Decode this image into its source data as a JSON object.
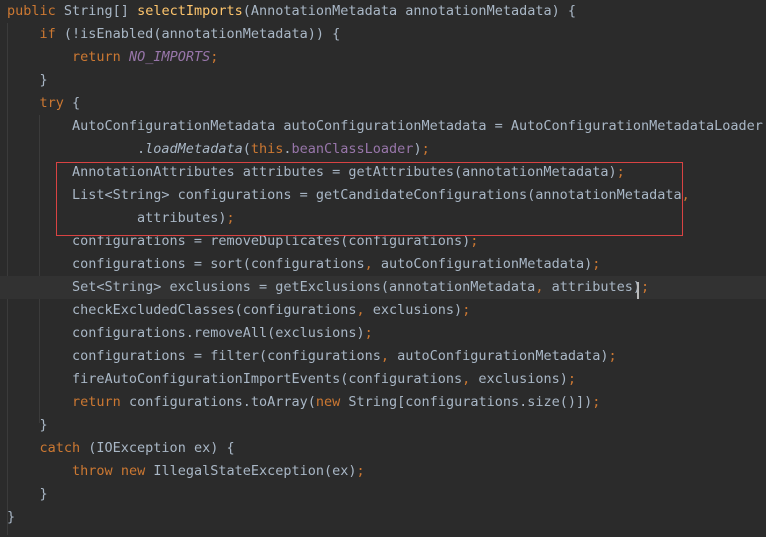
{
  "editor": {
    "theme_colors": {
      "background": "#2b2b2b",
      "current_line": "#323232",
      "keyword": "#cc7832",
      "method_declaration": "#ffc66d",
      "constant_field": "#9876aa",
      "default_text": "#a9b7c6",
      "highlight_box": "#d94343"
    },
    "current_line_number": 13,
    "highlighted_lines": [
      8,
      9,
      10
    ],
    "lines": [
      [
        {
          "t": "public",
          "c": "kw"
        },
        {
          "t": " String[] "
        },
        {
          "t": "selectImports",
          "c": "fn"
        },
        {
          "t": "(AnnotationMetadata annotationMetadata) {"
        }
      ],
      [
        {
          "t": "    "
        },
        {
          "t": "if",
          "c": "kw"
        },
        {
          "t": " (!isEnabled(annotationMetadata)) {"
        }
      ],
      [
        {
          "t": "        "
        },
        {
          "t": "return",
          "c": "kw"
        },
        {
          "t": " "
        },
        {
          "t": "NO_IMPORTS",
          "c": "const"
        },
        {
          "t": ";",
          "c": "kw"
        }
      ],
      [
        {
          "t": "    }"
        }
      ],
      [
        {
          "t": "    "
        },
        {
          "t": "try",
          "c": "kw"
        },
        {
          "t": " {"
        }
      ],
      [
        {
          "t": "        AutoConfigurationMetadata autoConfigurationMetadata = AutoConfigurationMetadataLoader"
        }
      ],
      [
        {
          "t": "                ."
        },
        {
          "t": "loadMetadata",
          "c": "static"
        },
        {
          "t": "("
        },
        {
          "t": "this",
          "c": "kw"
        },
        {
          "t": "."
        },
        {
          "t": "beanClassLoader",
          "c": "field"
        },
        {
          "t": ")"
        },
        {
          "t": ";",
          "c": "kw"
        }
      ],
      [
        {
          "t": "        AnnotationAttributes attributes = getAttributes(annotationMetadata)"
        },
        {
          "t": ";",
          "c": "kw"
        }
      ],
      [
        {
          "t": "        List<String> configurations = getCandidateConfigurations(annotationMetadata"
        },
        {
          "t": ",",
          "c": "kw"
        }
      ],
      [
        {
          "t": "                attributes)"
        },
        {
          "t": ";",
          "c": "kw"
        }
      ],
      [
        {
          "t": "        configurations = removeDuplicates(configurations)"
        },
        {
          "t": ";",
          "c": "kw"
        }
      ],
      [
        {
          "t": "        configurations = sort(configurations"
        },
        {
          "t": ",",
          "c": "kw"
        },
        {
          "t": " autoConfigurationMetadata)"
        },
        {
          "t": ";",
          "c": "kw"
        }
      ],
      [
        {
          "t": "        Set<String> exclusions = getExclusions(annotationMetadata"
        },
        {
          "t": ",",
          "c": "kw"
        },
        {
          "t": " attributes)"
        },
        {
          "t": ";",
          "c": "kw"
        }
      ],
      [
        {
          "t": "        checkExcludedClasses(configurations"
        },
        {
          "t": ",",
          "c": "kw"
        },
        {
          "t": " exclusions)"
        },
        {
          "t": ";",
          "c": "kw"
        }
      ],
      [
        {
          "t": "        configurations.removeAll(exclusions)"
        },
        {
          "t": ";",
          "c": "kw"
        }
      ],
      [
        {
          "t": "        configurations = filter(configurations"
        },
        {
          "t": ",",
          "c": "kw"
        },
        {
          "t": " autoConfigurationMetadata)"
        },
        {
          "t": ";",
          "c": "kw"
        }
      ],
      [
        {
          "t": "        fireAutoConfigurationImportEvents(configurations"
        },
        {
          "t": ",",
          "c": "kw"
        },
        {
          "t": " exclusions)"
        },
        {
          "t": ";",
          "c": "kw"
        }
      ],
      [
        {
          "t": "        "
        },
        {
          "t": "return",
          "c": "kw"
        },
        {
          "t": " configurations.toArray("
        },
        {
          "t": "new",
          "c": "kw"
        },
        {
          "t": " String[configurations.size()])"
        },
        {
          "t": ";",
          "c": "kw"
        }
      ],
      [
        {
          "t": "    }"
        }
      ],
      [
        {
          "t": "    "
        },
        {
          "t": "catch",
          "c": "kw"
        },
        {
          "t": " (IOException ex) {"
        }
      ],
      [
        {
          "t": "        "
        },
        {
          "t": "throw",
          "c": "kw"
        },
        {
          "t": " "
        },
        {
          "t": "new",
          "c": "kw"
        },
        {
          "t": " IllegalStateException(ex)"
        },
        {
          "t": ";",
          "c": "kw"
        }
      ],
      [
        {
          "t": "    }"
        }
      ],
      [
        {
          "t": "}"
        }
      ]
    ]
  }
}
